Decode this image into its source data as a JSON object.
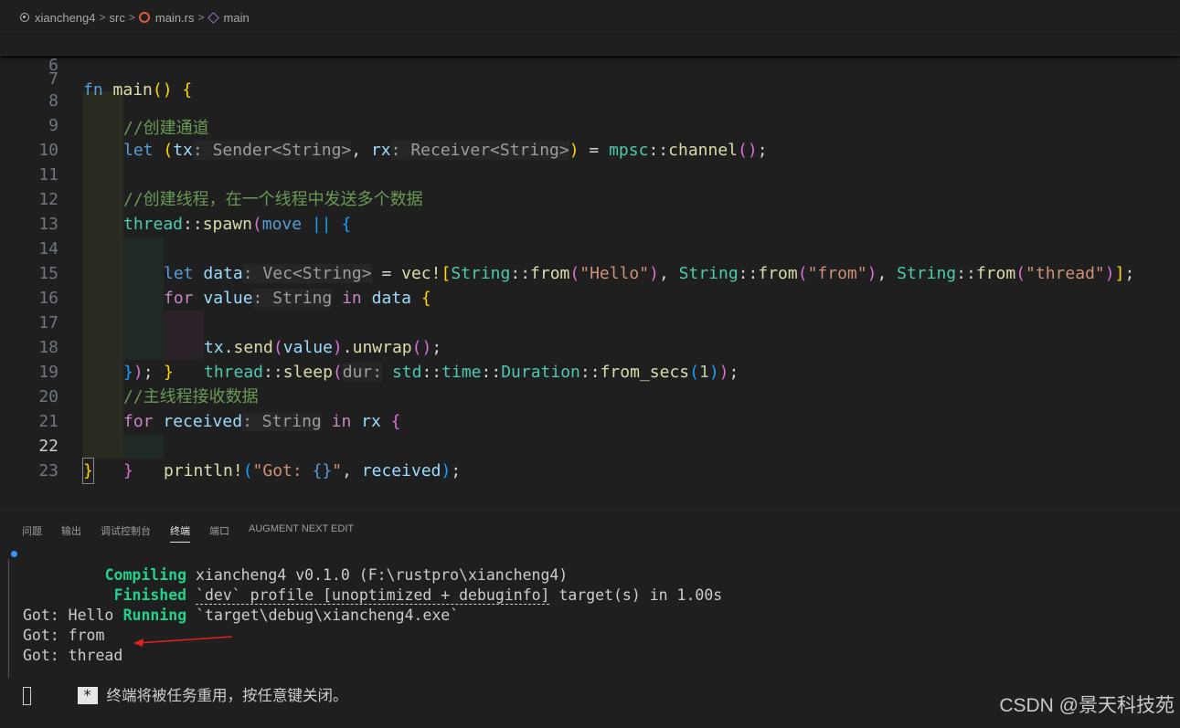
{
  "breadcrumb": {
    "items": [
      "xiancheng4",
      "src",
      "main.rs",
      "main"
    ],
    "separator": ">"
  },
  "editor": {
    "sticky": {
      "line_number": "6",
      "text": "fn main() {"
    },
    "lines": [
      {
        "n": "7",
        "text": "    //创建通道"
      },
      {
        "n": "8",
        "text": "    let (tx: Sender<String>, rx: Receiver<String>) = mpsc::channel();"
      },
      {
        "n": "9",
        "text": ""
      },
      {
        "n": "10",
        "text": "    //创建线程，在一个线程中发送多个数据"
      },
      {
        "n": "11",
        "text": "    thread::spawn(move || {"
      },
      {
        "n": "12",
        "text": "        let data: Vec<String> = vec![String::from(\"Hello\"), String::from(\"from\"), String::from(\"thread\")];"
      },
      {
        "n": "13",
        "text": "        for value: String in data {"
      },
      {
        "n": "14",
        "text": "            tx.send(value).unwrap();"
      },
      {
        "n": "15",
        "text": "            thread::sleep(dur: std::time::Duration::from_secs(1));"
      },
      {
        "n": "16",
        "text": "        }"
      },
      {
        "n": "17",
        "text": "    });"
      },
      {
        "n": "18",
        "text": "    //主线程接收数据"
      },
      {
        "n": "19",
        "text": "    for received: String in rx {"
      },
      {
        "n": "20",
        "text": "        println!(\"Got: {}\", received);"
      },
      {
        "n": "21",
        "text": "    }"
      },
      {
        "n": "22",
        "text": "}"
      },
      {
        "n": "23",
        "text": ""
      }
    ],
    "current_line": "22"
  },
  "panel": {
    "tabs": [
      "问题",
      "输出",
      "调试控制台",
      "终端",
      "端口",
      "AUGMENT NEXT EDIT"
    ],
    "active_tab": "终端",
    "terminal": {
      "compiling_label": "Compiling",
      "compiling_text": "xiancheng4 v0.1.0 (F:\\rustpro\\xiancheng4)",
      "finished_label": "Finished",
      "finished_text": "`dev` profile [unoptimized + debuginfo]",
      "finished_tail": " target(s) in 1.00s",
      "running_label": "Running",
      "running_text": "`target\\debug\\xiancheng4.exe`",
      "outputs": [
        "Got: Hello",
        "Got: from",
        "Got: thread"
      ],
      "star": "*",
      "reuse_message": "终端将被任务重用，按任意键关闭。"
    }
  },
  "watermark": "CSDN @景天科技苑",
  "colors": {
    "accent": "#23d18b",
    "arrow": "#e0201c",
    "background": "#1f1f1f"
  }
}
